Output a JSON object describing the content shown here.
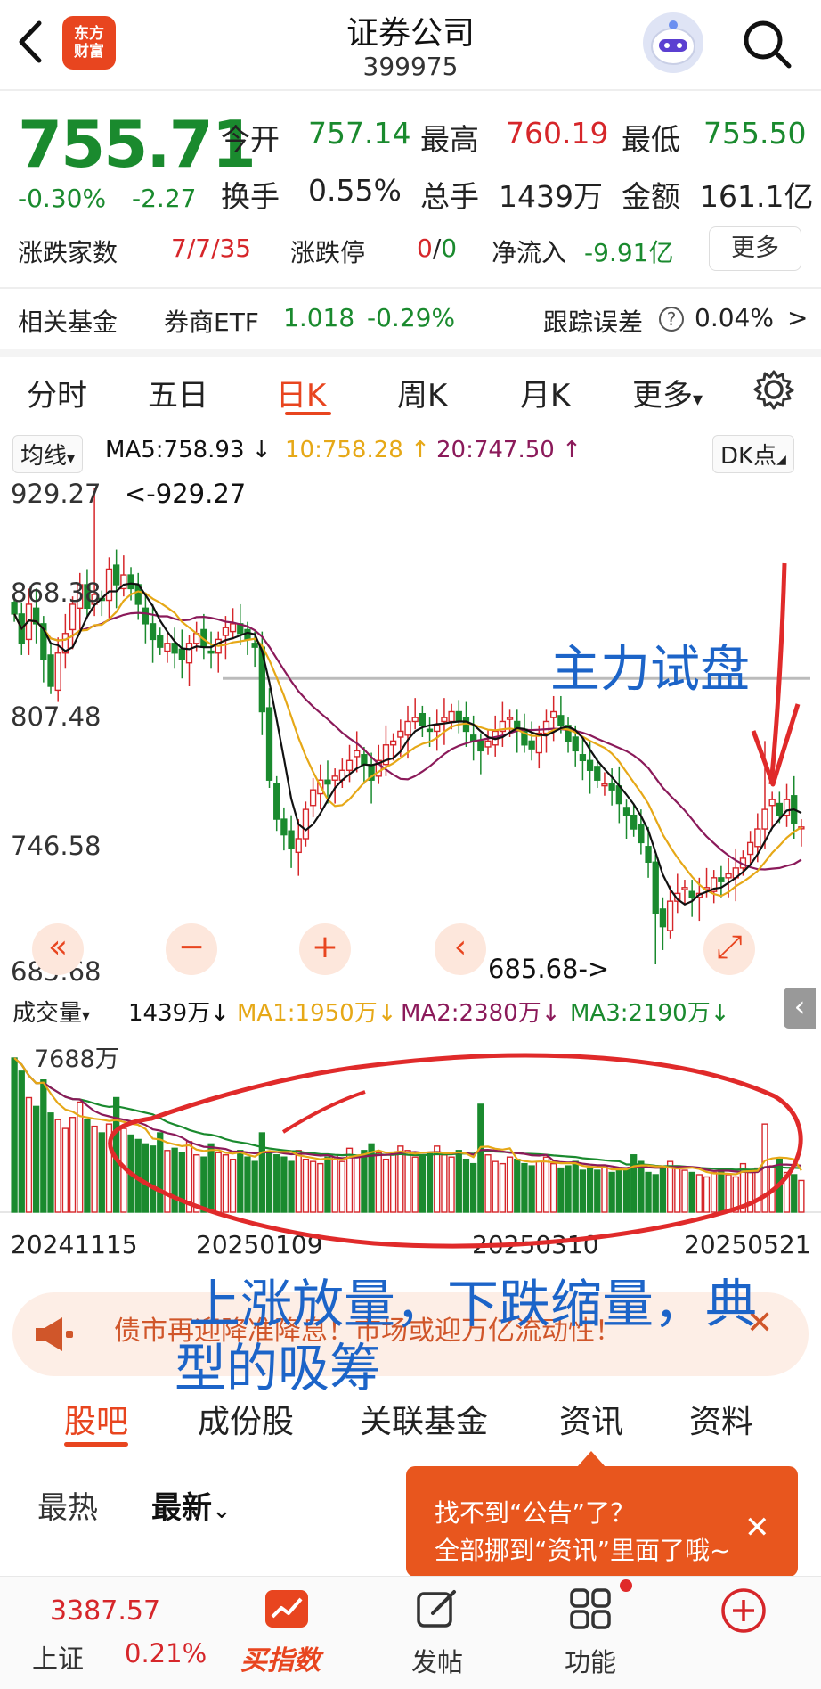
{
  "header": {
    "title": "证券公司",
    "code": "399975",
    "logo_text_1": "东方",
    "logo_text_2": "财富",
    "icons": [
      "back-arrow-icon",
      "search-icon",
      "robot-avatar-icon"
    ]
  },
  "quote": {
    "price": "755.71",
    "change_pct": "-0.30%",
    "change_abs": "-2.27",
    "open_label": "今开",
    "open": "757.14",
    "high_label": "最高",
    "high": "760.19",
    "low_label": "最低",
    "low": "755.50",
    "turnover_label": "换手",
    "turnover": "0.55%",
    "volume_label": "总手",
    "volume": "1439万",
    "amount_label": "金额",
    "amount": "161.1亿",
    "breadth_label": "涨跌家数",
    "breadth": "7/7/35",
    "limit_label": "涨跌停",
    "limit_up": "0",
    "limit_sep": "/",
    "limit_down": "0",
    "netflow_label": "净流入",
    "netflow": "-9.91亿",
    "more_label": "更多"
  },
  "fund": {
    "label": "相关基金",
    "name": "券商ETF",
    "price": "1.018",
    "change": "-0.29%",
    "tracking_label": "跟踪误差",
    "tracking": "0.04%",
    "chevron": ">"
  },
  "tabs": [
    {
      "label": "分时"
    },
    {
      "label": "五日"
    },
    {
      "label": "日K"
    },
    {
      "label": "周K"
    },
    {
      "label": "月K"
    },
    {
      "label": "更多"
    }
  ],
  "tabs_more_caret": "▾",
  "ma_bar": {
    "selector": "均线",
    "caret": "▾",
    "ma5": "MA5:758.93 ↓",
    "ma10": "10:758.28 ↑",
    "ma20": "20:747.50 ↑",
    "dk": "DK点",
    "dk_caret": "◢"
  },
  "price_axis": [
    "929.27",
    "868.38",
    "807.48",
    "746.58",
    "685.68"
  ],
  "high_marker": "<-929.27",
  "low_marker": "685.68->",
  "vol_bar": {
    "selector": "成交量",
    "caret": "▾",
    "vol": "1439万↓",
    "ma1": "MA1:1950万↓",
    "ma2": "MA2:2380万↓",
    "ma3": "MA3:2190万↓",
    "collapse": "‹"
  },
  "vol_axis_top": "7688万",
  "dates": [
    "20241115",
    "20250109",
    "20250310",
    "20250521"
  ],
  "controls": [
    "«",
    "−",
    "+",
    "‹",
    "⤢"
  ],
  "annotations": {
    "test": "主力试盘",
    "absorb_line1": "上涨放量，下跌缩量，典",
    "absorb_line2": "型的吸筹"
  },
  "notice": {
    "text": "债市再迎降准降息！市场或迎万亿流动性！",
    "close": "✕"
  },
  "subtabs": [
    {
      "label": "股吧"
    },
    {
      "label": "成份股"
    },
    {
      "label": "关联基金"
    },
    {
      "label": "资讯"
    },
    {
      "label": "资料"
    }
  ],
  "feed": {
    "hot": "最热",
    "latest": "最新",
    "latest_caret": "⌄"
  },
  "tooltip": {
    "line1": "找不到“公告”了？",
    "line2": "全部挪到“资讯”里面了哦~",
    "close": "✕"
  },
  "bottom_nav": {
    "index_value": "3387.57",
    "index_name": "上证",
    "index_change": "0.21%",
    "buy_index": "买指数",
    "post": "发帖",
    "func": "功能"
  },
  "colors": {
    "up": "#d6262a",
    "down": "#1a8a2e",
    "accent": "#e8451f",
    "ma5": "#111111",
    "ma10": "#e6a817",
    "ma20": "#8b1a5a",
    "annotation_red": "#e02a2a",
    "annotation_blue": "#1c64c8"
  },
  "chart_data": {
    "type": "candlestick",
    "period": "daily",
    "date_range": [
      "20241115",
      "20250521"
    ],
    "ylim": [
      685.68,
      929.27
    ],
    "y_ticks": [
      929.27,
      868.38,
      807.48,
      746.58,
      685.68
    ],
    "highest": 929.27,
    "lowest": 685.68,
    "ma": {
      "MA5": 758.93,
      "MA10": 758.28,
      "MA20": 747.5
    },
    "close_approx": [
      865,
      850,
      870,
      860,
      842,
      828,
      845,
      855,
      870,
      880,
      868,
      875,
      872,
      888,
      880,
      885,
      878,
      870,
      860,
      852,
      848,
      850,
      845,
      842,
      850,
      855,
      848,
      845,
      852,
      858,
      860,
      855,
      852,
      848,
      815,
      780,
      760,
      752,
      745,
      750,
      765,
      775,
      780,
      778,
      782,
      785,
      790,
      795,
      788,
      780,
      790,
      798,
      800,
      805,
      810,
      812,
      808,
      805,
      808,
      812,
      815,
      810,
      805,
      800,
      795,
      800,
      805,
      810,
      812,
      806,
      798,
      796,
      804,
      810,
      815,
      808,
      800,
      795,
      790,
      785,
      780,
      778,
      775,
      768,
      762,
      755,
      748,
      738,
      712,
      705,
      718,
      722,
      725,
      720,
      722,
      725,
      730,
      728,
      732,
      735,
      740,
      748,
      755,
      765,
      770,
      762,
      770,
      758,
      756
    ],
    "volume": {
      "unit": "万",
      "top": 7688,
      "last": 1439,
      "MA1": 1950,
      "MA2": 2380,
      "MA3": 2190,
      "values_approx": [
        7000,
        6400,
        5200,
        4800,
        6000,
        4500,
        4200,
        3800,
        4300,
        5000,
        4200,
        3900,
        3600,
        4000,
        5200,
        3800,
        3500,
        3300,
        3100,
        3000,
        3600,
        2800,
        2900,
        2700,
        3200,
        2600,
        2500,
        3100,
        2700,
        2600,
        2400,
        2800,
        2500,
        2300,
        3600,
        2700,
        2600,
        2500,
        2300,
        2800,
        2400,
        2300,
        2200,
        2500,
        2600,
        2300,
        2900,
        2500,
        2800,
        3100,
        2700,
        2400,
        2600,
        3000,
        2800,
        2500,
        2600,
        2700,
        3000,
        2600,
        2500,
        2800,
        2400,
        2200,
        4900,
        2600,
        2300,
        2200,
        2500,
        2400,
        2200,
        2100,
        2300,
        2500,
        2200,
        2000,
        2100,
        2300,
        1900,
        2000,
        1900,
        2100,
        1800,
        1900,
        2000,
        2600,
        2300,
        1800,
        1700,
        2000,
        2300,
        2100,
        1900,
        1800,
        1700,
        1600,
        1800,
        1900,
        1700,
        1600,
        2200,
        1900,
        2000,
        4000,
        2100,
        2400,
        1800,
        1700,
        1439
      ]
    }
  }
}
